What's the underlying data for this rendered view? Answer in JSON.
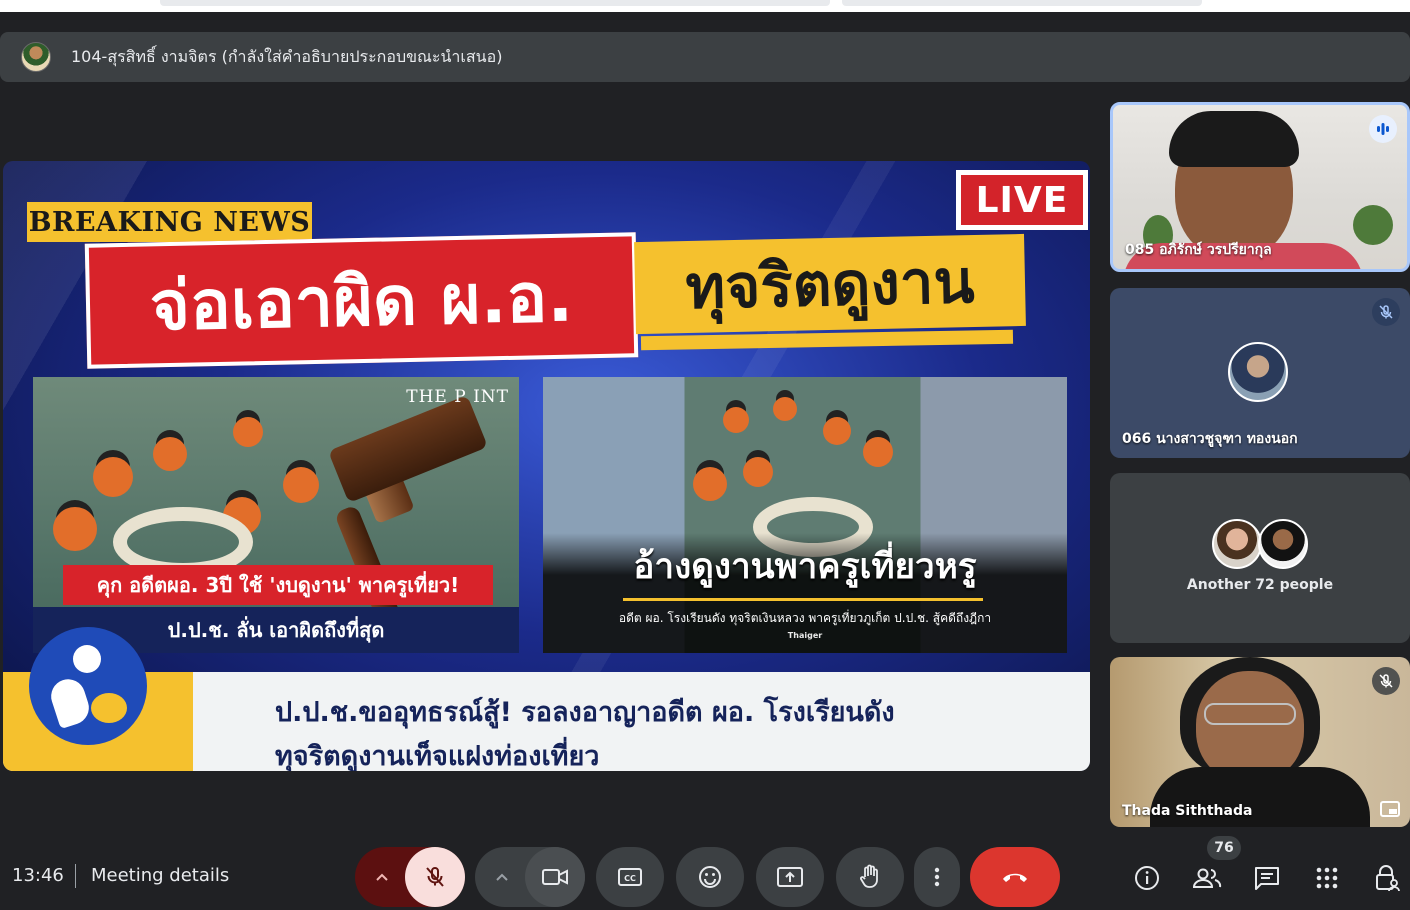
{
  "presenter": {
    "text": "104-สุรสิทธิ์ งามจิตร (กำลังใส่คำอธิบายประกอบขณะนำเสนอ)"
  },
  "shared_screen": {
    "breaking_label": "BREAKING NEWS",
    "live_label": "LIVE",
    "headline_red": "จ่อเอาผิด ผ.อ.",
    "headline_yellow": "ทุจริตดูงาน",
    "left_photo": {
      "watermark": "THE P INT",
      "caption_red": "คุก อดีตผอ. 3ปี ใช้ 'งบดูงาน' พาครูเที่ยว!",
      "caption_blue": "ป.ป.ช. ลั่น เอาผิดถึงที่สุด"
    },
    "right_photo": {
      "caption_big": "อ้างดูงานพาครูเที่ยวหรู",
      "caption_small": "อดีต ผอ. โรงเรียนดัง ทุจริตเงินหลวง พาครูเที่ยวภูเก็ต ป.ป.ช. สู้คดีถึงฎีกา",
      "source": "Thaiger"
    },
    "band_line1": "ป.ป.ช.ขออุทธรณ์สู้! รอลงอาญาอดีต ผอ. โรงเรียนดัง",
    "band_line2": "ทุจริตดูงานเท็จแฝงท่องเที่ยว"
  },
  "participants": [
    {
      "name": "085 อภิรักษ์ วรปรียากุล",
      "status": "speaking"
    },
    {
      "name": "066 นางสาวชูจุฑา ทองนอก",
      "status": "muted"
    },
    {
      "name": "Another 72 people",
      "status": "group"
    },
    {
      "name": "Thada Siththada",
      "status": "muted"
    }
  ],
  "toolbar": {
    "time": "13:46",
    "meeting_details": "Meeting details",
    "people_count": "76",
    "buttons": [
      "mic-options",
      "microphone-off",
      "camera-options",
      "camera",
      "captions",
      "reactions",
      "present-screen",
      "raise-hand",
      "more-options",
      "leave-call"
    ],
    "right_icons": [
      "info-icon",
      "people-icon",
      "chat-icon",
      "activities-icon",
      "host-controls-icon"
    ]
  },
  "colors": {
    "background": "#202124",
    "surface": "#3c4043",
    "leave_red": "#dc362e",
    "mic_off_bg": "#f9dedc",
    "speaking_border": "#a8c7fa",
    "news_red": "#d8232a",
    "news_yellow": "#f5c12e"
  }
}
